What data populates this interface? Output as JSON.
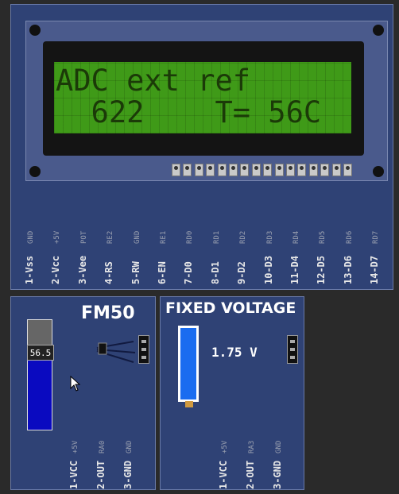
{
  "lcd": {
    "line1": "ADC ext ref",
    "line2": "  622    T= 56C",
    "pins": [
      {
        "label": "1-Vss",
        "sub": "GND"
      },
      {
        "label": "2-Vcc",
        "sub": "+5V"
      },
      {
        "label": "3-Vee",
        "sub": "POT"
      },
      {
        "label": "4-RS",
        "sub": "RE2"
      },
      {
        "label": "5-RW",
        "sub": "GND"
      },
      {
        "label": "6-EN",
        "sub": "RE1"
      },
      {
        "label": "7-D0",
        "sub": "RD0"
      },
      {
        "label": "8-D1",
        "sub": "RD1"
      },
      {
        "label": "9-D2",
        "sub": "RD2"
      },
      {
        "label": "10-D3",
        "sub": "RD3"
      },
      {
        "label": "11-D4",
        "sub": "RD4"
      },
      {
        "label": "12-D5",
        "sub": "RD5"
      },
      {
        "label": "13-D6",
        "sub": "RD6"
      },
      {
        "label": "14-D7",
        "sub": "RD7"
      }
    ]
  },
  "fm50": {
    "title": "FM50",
    "slider_value": "56.5",
    "fill_fraction": 0.7,
    "pins": [
      {
        "label": "1-VCC",
        "sub": "+5V"
      },
      {
        "label": "2-OUT",
        "sub": "RA0"
      },
      {
        "label": "3-GND",
        "sub": "GND"
      }
    ]
  },
  "fixed_voltage": {
    "title": "FIXED VOLTAGE",
    "value": "1.75 V",
    "pins": [
      {
        "label": "1-VCC",
        "sub": "+5V"
      },
      {
        "label": "2-OUT",
        "sub": "RA3"
      },
      {
        "label": "3-GND",
        "sub": "GND"
      }
    ]
  }
}
